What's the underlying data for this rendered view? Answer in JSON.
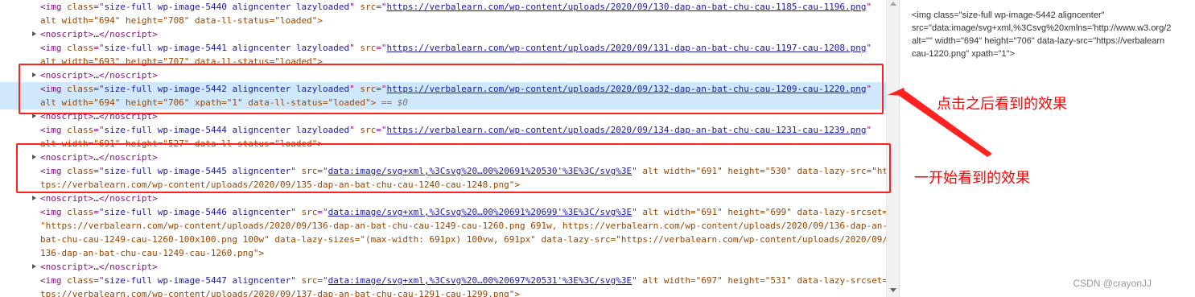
{
  "elements_panel": {
    "lines": [
      {
        "type": "img",
        "indent": "    ",
        "img_class": "size-full wp-image-5440 aligncenter lazyloaded",
        "src": "https://verbalearn.com/wp-content/uploads/2020/09/130-dap-an-bat-chu-cau-1185-cau-1196.png"
      },
      {
        "type": "raw",
        "indent": "    ",
        "text": "alt width=\"694\" height=\"708\" data-ll-status=\"loaded\">"
      },
      {
        "type": "noscript",
        "indent": "    ",
        "open": "<noscript>",
        "ellipsis": "…",
        "close": "</noscript>"
      },
      {
        "type": "img",
        "indent": "    ",
        "img_class": "size-full wp-image-5441 aligncenter lazyloaded",
        "src": "https://verbalearn.com/wp-content/uploads/2020/09/131-dap-an-bat-chu-cau-1197-cau-1208.png"
      },
      {
        "type": "raw",
        "indent": "    ",
        "text": "alt width=\"693\" height=\"707\" data-ll-status=\"loaded\">"
      },
      {
        "type": "noscript",
        "indent": "    ",
        "open": "<noscript>",
        "ellipsis": "…",
        "close": "</noscript>"
      },
      {
        "type": "img",
        "indent": "    ",
        "img_class": "size-full wp-image-5442 aligncenter lazyloaded",
        "src": "https://verbalearn.com/wp-content/uploads/2020/09/132-dap-an-bat-chu-cau-1209-cau-1220.png",
        "selected": true
      },
      {
        "type": "raw",
        "indent": "    ",
        "text": "alt width=\"694\" height=\"706\" xpath=\"1\" data-ll-status=\"loaded\">",
        "suffix": " == $0",
        "selected": true
      },
      {
        "type": "noscript",
        "indent": "    ",
        "open": "<noscript>",
        "ellipsis": "…",
        "close": "</noscript>"
      },
      {
        "type": "img",
        "indent": "    ",
        "img_class": "size-full wp-image-5444 aligncenter lazyloaded",
        "src": "https://verbalearn.com/wp-content/uploads/2020/09/134-dap-an-bat-chu-cau-1231-cau-1239.png"
      },
      {
        "type": "raw",
        "indent": "    ",
        "text": "alt width=\"691\" height=\"527\" data-ll-status=\"loaded\">"
      },
      {
        "type": "noscript",
        "indent": "    ",
        "open": "<noscript>",
        "ellipsis": "…",
        "close": "</noscript>"
      },
      {
        "type": "img2",
        "indent": "    ",
        "img_class": "size-full wp-image-5445 aligncenter",
        "src": "data:image/svg+xml,%3Csvg%20…00%20691%20530'%3E%3C/svg%3E",
        "tail": " alt width=\"691\" height=\"530\" data-lazy-src=\"ht"
      },
      {
        "type": "raw",
        "indent": "    ",
        "text": "tps://verbalearn.com/wp-content/uploads/2020/09/135-dap-an-bat-chu-cau-1240-cau-1248.png\">"
      },
      {
        "type": "noscript",
        "indent": "    ",
        "open": "<noscript>",
        "ellipsis": "…",
        "close": "</noscript>"
      },
      {
        "type": "img2",
        "indent": "    ",
        "img_class": "size-full wp-image-5446 aligncenter",
        "src": "data:image/svg+xml,%3Csvg%20…00%20691%20699'%3E%3C/svg%3E",
        "tail": " alt width=\"691\" height=\"699\" data-lazy-srcset="
      },
      {
        "type": "raw",
        "indent": "    ",
        "text": "\"https://verbalearn.com/wp-content/uploads/2020/09/136-dap-an-bat-chu-cau-1249-cau-1260.png 691w, https://verbalearn.com/wp-content/uploads/2020/09/136-dap-an-"
      },
      {
        "type": "raw",
        "indent": "    ",
        "text": "bat-chu-cau-1249-cau-1260-100x100.png 100w\" data-lazy-sizes=\"(max-width: 691px) 100vw, 691px\" data-lazy-src=\"https://verbalearn.com/wp-content/uploads/2020/09/"
      },
      {
        "type": "raw",
        "indent": "    ",
        "text": "136-dap-an-bat-chu-cau-1249-cau-1260.png\">"
      },
      {
        "type": "noscript",
        "indent": "    ",
        "open": "<noscript>",
        "ellipsis": "…",
        "close": "</noscript>"
      },
      {
        "type": "img2",
        "indent": "    ",
        "img_class": "size-full wp-image-5447 aligncenter",
        "src": "data:image/svg+xml,%3Csvg%20…00%20697%20531'%3E%3C/svg%3E",
        "tail": " alt width=\"697\" height=\"531\" data-lazy-srcset=\"ht"
      },
      {
        "type": "raw",
        "indent": "    ",
        "text": "tps://verbalearn.com/wp-content/uploads/2020/09/137-dap-an-bat-chu-cau-1291-cau-1299.png\">"
      }
    ]
  },
  "right_panel": {
    "lines": [
      "<img class=\"size-full wp-image-5442 aligncenter\"",
      "src=\"data:image/svg+xml,%3Csvg%20xmlns='http://www.w3.org/2",
      "alt=\"\" width=\"694\" height=\"706\" data-lazy-src=\"https://verbalearn",
      "cau-1220.png\" xpath=\"1\">"
    ]
  },
  "annotations": {
    "after_click": "点击之后看到的效果",
    "initial": "一开始看到的效果",
    "watermark": "CSDN @crayonJJ",
    "color": "#ff0000"
  },
  "icons": {
    "expand_caret": "caret-right-icon",
    "scroll_up": "scroll-up-icon",
    "scroll_down": "scroll-down-icon",
    "pointer_arrow": "arrow-icon"
  }
}
